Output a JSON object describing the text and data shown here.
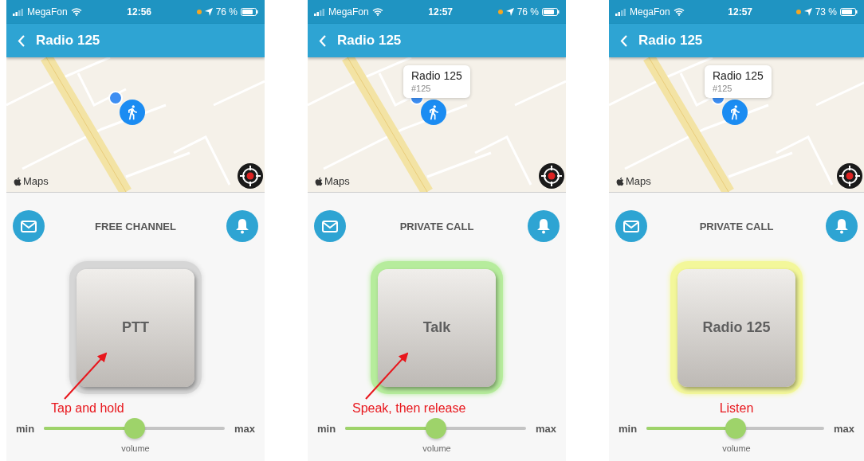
{
  "phones": [
    {
      "status_bar": {
        "carrier": "MegaFon",
        "time": "12:56",
        "battery": "76 %"
      },
      "title": "Radio 125",
      "map": {
        "attribution": "Maps"
      },
      "channel": "FREE CHANNEL",
      "ptt": {
        "label": "PTT",
        "kind": "idle"
      },
      "annotation": {
        "text": "Tap and hold",
        "arrow": true
      },
      "volume": {
        "min": "min",
        "max": "max",
        "caption": "volume",
        "level": 0.5
      }
    },
    {
      "status_bar": {
        "carrier": "MegaFon",
        "time": "12:57",
        "battery": "76 %"
      },
      "title": "Radio 125",
      "map": {
        "attribution": "Maps",
        "callout": {
          "title": "Radio 125",
          "subtitle": "#125"
        }
      },
      "channel": "PRIVATE CALL",
      "ptt": {
        "label": "Talk",
        "kind": "talking"
      },
      "annotation": {
        "text": "Speak, then release",
        "arrow": true
      },
      "volume": {
        "min": "min",
        "max": "max",
        "caption": "volume",
        "level": 0.5
      }
    },
    {
      "status_bar": {
        "carrier": "MegaFon",
        "time": "12:57",
        "battery": "73 %"
      },
      "title": "Radio 125",
      "map": {
        "attribution": "Maps",
        "callout": {
          "title": "Radio 125",
          "subtitle": "#125"
        }
      },
      "channel": "PRIVATE CALL",
      "ptt": {
        "label": "Radio 125",
        "kind": "listening"
      },
      "annotation": {
        "text": "Listen",
        "arrow": false
      },
      "volume": {
        "min": "min",
        "max": "max",
        "caption": "volume",
        "level": 0.5
      }
    }
  ]
}
